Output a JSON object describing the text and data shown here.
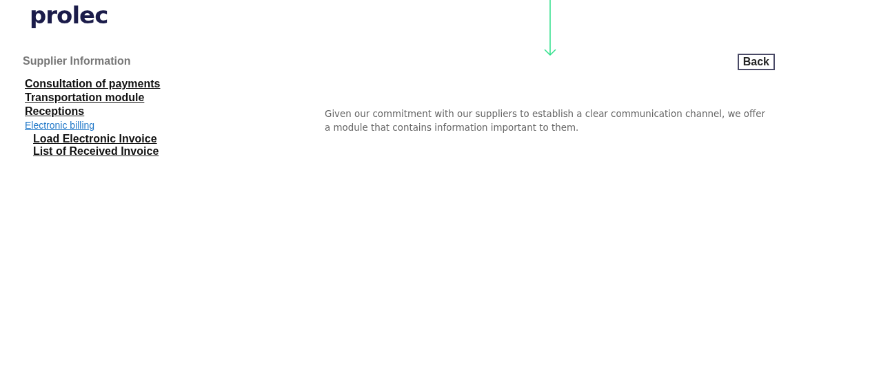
{
  "logo": "prolec",
  "sidebar": {
    "title": "Supplier Information",
    "items": [
      {
        "label": "Consultation of payments",
        "selected": false
      },
      {
        "label": "Transportation module",
        "selected": false
      },
      {
        "label": "Receptions",
        "selected": false
      },
      {
        "label": "Electronic billing",
        "selected": true,
        "children": [
          {
            "label": "Load Electronic Invoice",
            "selected": false
          },
          {
            "label": "List of Received Invoice",
            "selected": false
          }
        ]
      }
    ]
  },
  "back_button": "Back",
  "intro": "Given our commitment with our suppliers to establish a clear communication channel, we offer a module that contains information important to them."
}
